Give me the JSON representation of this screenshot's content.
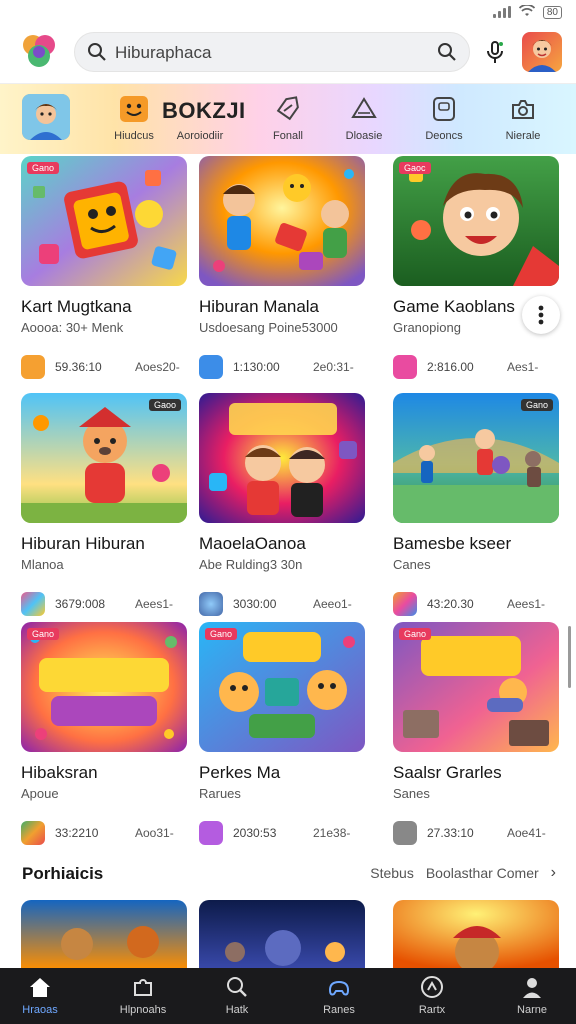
{
  "status_bar": {
    "battery": "80"
  },
  "search": {
    "value": "Hiburaphaca"
  },
  "categories": {
    "heading": "BOKZJI",
    "items": [
      {
        "label": "Hiudcus",
        "icon": "smiley-icon"
      },
      {
        "label": "Aoroiodiir",
        "icon": "blank-icon"
      },
      {
        "label": "Fonall",
        "icon": "tag-icon"
      },
      {
        "label": "Dloasie",
        "icon": "triangle-icon"
      },
      {
        "label": "Deoncs",
        "icon": "box-icon"
      },
      {
        "label": "Nierale",
        "icon": "camera-icon"
      }
    ]
  },
  "cards": [
    {
      "title": "Kart Mugtkana",
      "subtitle": "Aoooa: 30+ Menk",
      "size": "59.36:10",
      "action": "Aoes20-",
      "icon_color": "#f5a031",
      "badge": "Gano"
    },
    {
      "title": "Hiburan Manala",
      "subtitle": "Usdoesang Poine53000",
      "size": "1:130:00",
      "action": "2e0:31-",
      "icon_color": "#3c8de8",
      "badge": ""
    },
    {
      "title": "Game Kaoblans",
      "subtitle": "Granopiong",
      "size": "2:816.00",
      "action": "Aes1-",
      "icon_color": "#e94ba0",
      "badge": "Gaoc"
    },
    {
      "title": "Hiburan Hiburan",
      "subtitle": "Mlanoa",
      "size": "3679:008",
      "action": "Aees1-",
      "icon_color": "#ec5a8c",
      "badge": "Gaoo"
    },
    {
      "title": "MaoelaOanoa",
      "subtitle": "Abe Rulding3 30n",
      "size": "3030:00",
      "action": "Aeeo1-",
      "icon_color": "#4468a8",
      "badge": ""
    },
    {
      "title": "Bamesbe kseer",
      "subtitle": "Canes",
      "size": "43:20.30",
      "action": "Aees1-",
      "icon_color": "#f0a030",
      "badge": "Gano"
    },
    {
      "title": "Hibaksran",
      "subtitle": "Apoue",
      "size": "33:2210",
      "action": "Aoo31-",
      "icon_color": "#3fae6a",
      "badge": "Gano"
    },
    {
      "title": "Perkes Ma",
      "subtitle": "Rarues",
      "size": "2030:53",
      "action": "21e38-",
      "icon_color": "#b45ce0",
      "badge": "Gano"
    },
    {
      "title": "Saalsr Grarles",
      "subtitle": "Sanes",
      "size": "27.33:10",
      "action": "Aoe41-",
      "icon_color": "#888888",
      "badge": "Gano"
    }
  ],
  "section": {
    "title": "Porhiaicis",
    "links": [
      "Stebus",
      "Boolasthar Comer"
    ]
  },
  "nav": [
    {
      "label": "Hraoas",
      "icon": "home-icon"
    },
    {
      "label": "Hlpnoahs",
      "icon": "puzzle-icon"
    },
    {
      "label": "Hatk",
      "icon": "search-icon"
    },
    {
      "label": "Ranes",
      "icon": "gamepad-icon"
    },
    {
      "label": "Rartx",
      "icon": "compass-icon"
    },
    {
      "label": "Narne",
      "icon": "profile-icon"
    }
  ]
}
